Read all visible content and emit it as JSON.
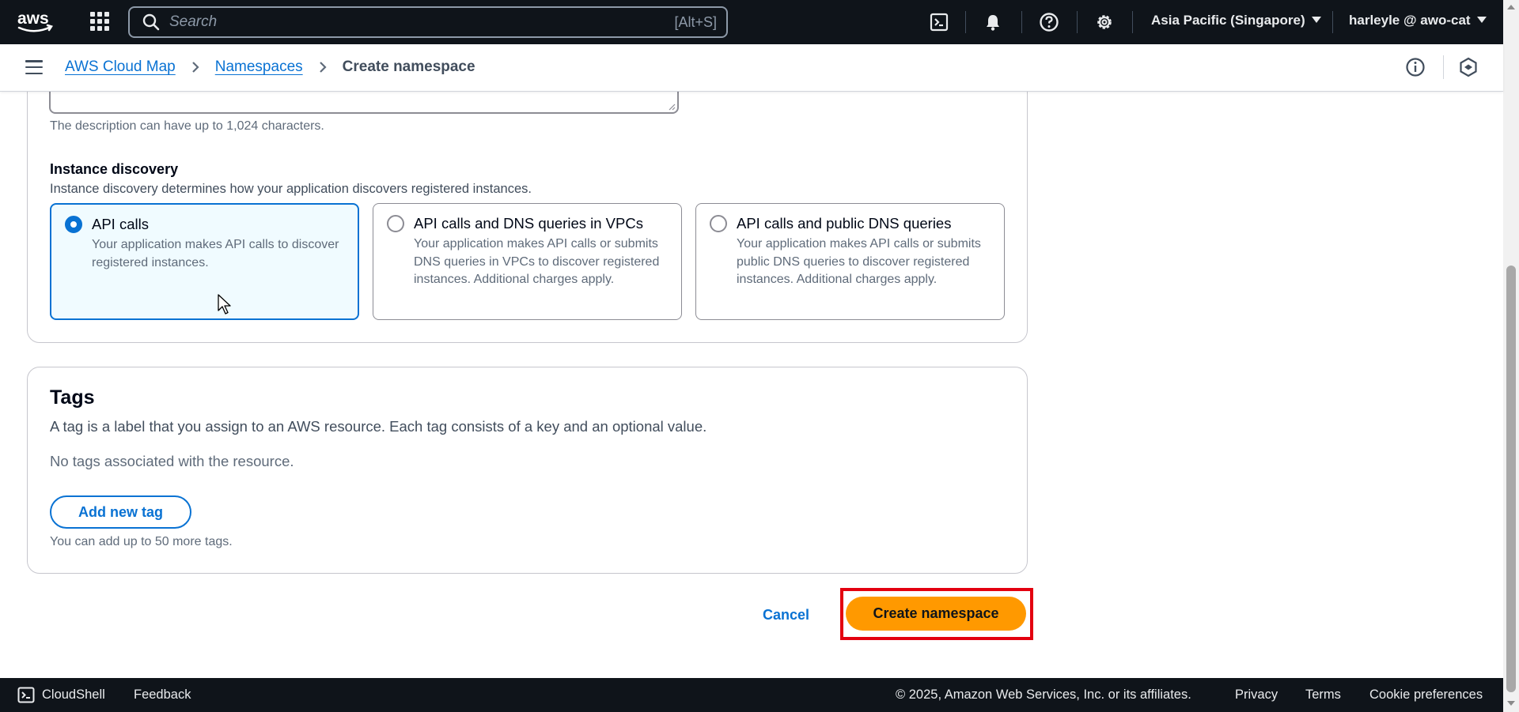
{
  "topnav": {
    "logo_text": "aws",
    "search_placeholder": "Search",
    "search_shortcut": "[Alt+S]",
    "region": "Asia Pacific (Singapore)",
    "account": "harleyle @ awo-cat",
    "icons": [
      "services-grid-icon",
      "search-icon",
      "cloudshell-icon",
      "bell-icon",
      "help-icon",
      "settings-icon"
    ]
  },
  "breadcrumb": {
    "items": [
      "AWS Cloud Map",
      "Namespaces"
    ],
    "current": "Create namespace"
  },
  "description_field": {
    "hint": "The description can have up to 1,024 characters."
  },
  "instance_discovery": {
    "label": "Instance discovery",
    "description": "Instance discovery determines how your application discovers registered instances.",
    "options": [
      {
        "title": "API calls",
        "description": "Your application makes API calls to discover registered instances.",
        "selected": true
      },
      {
        "title": "API calls and DNS queries in VPCs",
        "description": "Your application makes API calls or submits DNS queries in VPCs to discover registered instances. Additional charges apply.",
        "selected": false
      },
      {
        "title": "API calls and public DNS queries",
        "description": "Your application makes API calls or submits public DNS queries to discover registered instances. Additional charges apply.",
        "selected": false
      }
    ]
  },
  "tags": {
    "title": "Tags",
    "description": "A tag is a label that you assign to an AWS resource. Each tag consists of a key and an optional value.",
    "empty": "No tags associated with the resource.",
    "add_button": "Add new tag",
    "limit_hint": "You can add up to 50 more tags."
  },
  "actions": {
    "cancel": "Cancel",
    "submit": "Create namespace"
  },
  "footer": {
    "cloudshell": "CloudShell",
    "feedback": "Feedback",
    "copyright": "© 2025, Amazon Web Services, Inc. or its affiliates.",
    "privacy": "Privacy",
    "terms": "Terms",
    "cookies": "Cookie preferences"
  },
  "colors": {
    "nav_bg": "#0f141a",
    "link": "#0972d3",
    "primary_button": "#ff9900",
    "highlight": "#e3000f",
    "selected_tile_bg": "#f0fbff"
  }
}
